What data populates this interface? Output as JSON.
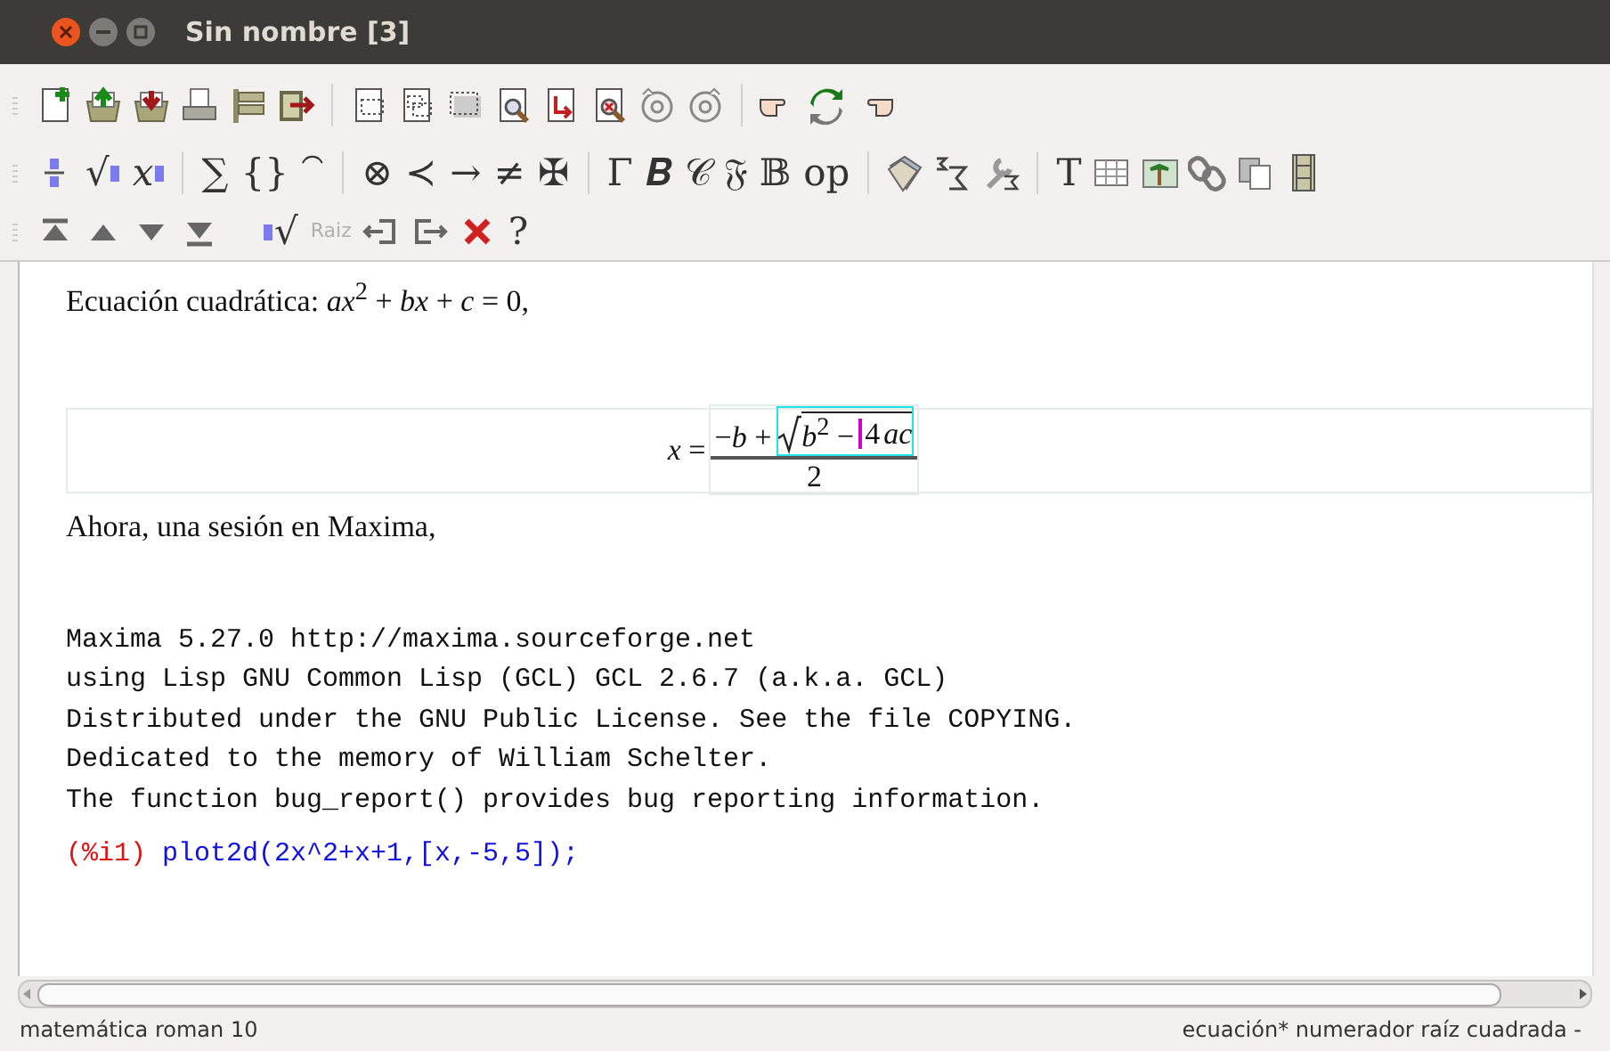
{
  "window": {
    "title": "Sin nombre [3]"
  },
  "toolbars": [
    {
      "items": [
        {
          "kind": "icon"
        },
        {
          "kind": "icon"
        },
        {
          "kind": "icon"
        },
        {
          "kind": "icon"
        },
        {
          "kind": "icon"
        },
        {
          "kind": "icon"
        },
        {
          "kind": "sep"
        },
        {
          "kind": "icon"
        },
        {
          "kind": "icon"
        },
        {
          "kind": "icon"
        },
        {
          "kind": "icon"
        },
        {
          "kind": "icon"
        },
        {
          "kind": "icon"
        },
        {
          "kind": "icon"
        },
        {
          "kind": "icon"
        },
        {
          "kind": "sep"
        },
        {
          "kind": "icon"
        },
        {
          "kind": "icon"
        },
        {
          "kind": "icon"
        }
      ]
    },
    {
      "items": [
        {
          "kind": "icon"
        },
        {
          "kind": "slot",
          "label": "√",
          "disabled": false
        },
        {
          "kind": "slot",
          "label": "x",
          "disabled": false
        },
        {
          "kind": "sep"
        },
        {
          "kind": "glyph",
          "label": "∑",
          "disabled": false
        },
        {
          "kind": "glyph",
          "label": "{}",
          "disabled": false
        },
        {
          "kind": "glyph",
          "label": "⁀",
          "disabled": false
        },
        {
          "kind": "sep"
        },
        {
          "kind": "glyph",
          "label": "⊗",
          "disabled": false
        },
        {
          "kind": "glyph",
          "label": "≺",
          "disabled": false
        },
        {
          "kind": "glyph",
          "label": "→",
          "disabled": false
        },
        {
          "kind": "glyph",
          "label": "≠",
          "disabled": false
        },
        {
          "kind": "glyph",
          "label": "✠",
          "disabled": false
        },
        {
          "kind": "sep"
        },
        {
          "kind": "glyph",
          "label": "Γ",
          "disabled": false
        },
        {
          "kind": "glyph",
          "label": "𝑩",
          "disabled": false
        },
        {
          "kind": "glyph",
          "label": "𝒞",
          "disabled": false
        },
        {
          "kind": "glyph",
          "label": "𝔉",
          "disabled": false
        },
        {
          "kind": "glyph",
          "label": "𝔹",
          "disabled": false
        },
        {
          "kind": "glyph",
          "label": "op",
          "disabled": false
        },
        {
          "kind": "sep"
        },
        {
          "kind": "icon"
        },
        {
          "kind": "icon"
        },
        {
          "kind": "icon"
        },
        {
          "kind": "sep"
        },
        {
          "kind": "glyph",
          "label": "T",
          "disabled": false
        },
        {
          "kind": "icon"
        },
        {
          "kind": "icon"
        },
        {
          "kind": "icon"
        },
        {
          "kind": "icon"
        },
        {
          "kind": "icon"
        }
      ]
    },
    {
      "items": [
        {
          "kind": "icon"
        },
        {
          "kind": "icon"
        },
        {
          "kind": "icon"
        },
        {
          "kind": "icon"
        },
        {
          "kind": "gap"
        },
        {
          "kind": "preslot",
          "label": "√",
          "disabled": false
        },
        {
          "kind": "glyph",
          "label": "Raiz",
          "disabled": true
        },
        {
          "kind": "icon"
        },
        {
          "kind": "icon"
        },
        {
          "kind": "icon"
        },
        {
          "kind": "glyph",
          "label": "?",
          "disabled": false
        }
      ]
    }
  ],
  "document": {
    "intro": "Ecuación cuadrática: *ax*$^{2}$ + *bx* + *c* = 0,",
    "formula": {
      "lhs": "*x* =",
      "numerator_lead": "−*b* +",
      "radicand_before_cursor": "*b*$^{2}$ −",
      "radicand_coefficient": "4",
      "radicand_variables": "ac",
      "denominator": "2"
    },
    "session_intro": "Ahora, una sesión en Maxima,",
    "session_banner": [
      "Maxima 5.27.0 http://maxima.sourceforge.net",
      "using Lisp GNU Common Lisp (GCL) GCL 2.6.7 (a.k.a. GCL)",
      "Distributed under the GNU Public License. See the file COPYING.",
      "Dedicated to the memory of William Schelter.",
      "The function bug_report() provides bug reporting information."
    ],
    "prompt": {
      "label": "(%i1)",
      "input": "plot2d(2x^2+x+1,[x,-5,5]);"
    }
  },
  "status_bar": {
    "left": "matemática roman 10",
    "right": "ecuación* numerador raíz cuadrada -"
  }
}
